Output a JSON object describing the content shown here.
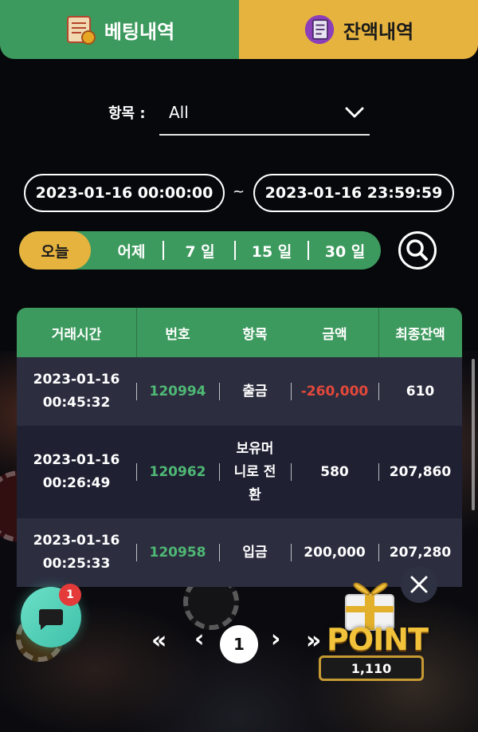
{
  "tabs": {
    "bet_history": "베팅내역",
    "balance_history": "잔액내역"
  },
  "filter": {
    "label": "항목 :",
    "selected": "All"
  },
  "dates": {
    "start": "2023-01-16 00:00:00",
    "separator": "~",
    "end": "2023-01-16 23:59:59"
  },
  "periods": [
    "오늘",
    "어제",
    "7 일",
    "15 일",
    "30 일"
  ],
  "table": {
    "headers": [
      "거래시간",
      "번호",
      "항목",
      "금액",
      "최종잔액"
    ],
    "rows": [
      {
        "time_date": "2023-01-16",
        "time_clock": "00:45:32",
        "number": "120994",
        "item": "출금",
        "amount": "-260,000",
        "balance": "610"
      },
      {
        "time_date": "2023-01-16",
        "time_clock": "00:26:49",
        "number": "120962",
        "item_l1": "보유머",
        "item_l2": "니로 전",
        "item_l3": "환",
        "amount": "580",
        "balance": "207,860"
      },
      {
        "time_date": "2023-01-16",
        "time_clock": "00:25:33",
        "number": "120958",
        "item": "입금",
        "amount": "200,000",
        "balance": "207,280"
      }
    ]
  },
  "pagination": {
    "first": "«",
    "prev": "‹",
    "current": "1",
    "next": "›",
    "last": "»"
  },
  "chat": {
    "badge": "1"
  },
  "point": {
    "label": "POINT",
    "value": "1,110"
  },
  "colors": {
    "green": "#3d9a5e",
    "gold": "#e6b33e",
    "negative": "#e4483a",
    "number_green": "#4fb874"
  }
}
